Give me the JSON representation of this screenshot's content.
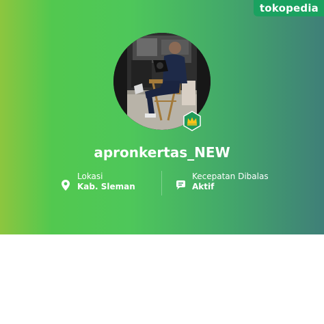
{
  "brand": {
    "logo_text": "tokopedia",
    "color": "#1aa260"
  },
  "profile": {
    "username": "apronkertas_NEW",
    "badge_icon": "crown-icon",
    "avatar": "profile-photo"
  },
  "info": {
    "location": {
      "icon": "location-pin-icon",
      "label": "Lokasi",
      "value": "Kab. Sleman"
    },
    "response": {
      "icon": "chat-bubble-icon",
      "label": "Kecepatan Dibalas",
      "value": "Aktif"
    }
  },
  "colors": {
    "gradient_start": "#8dc63f",
    "gradient_mid": "#4ec75a",
    "gradient_end": "#3f7f78",
    "badge_green": "#1f9b58",
    "crown_yellow": "#f7c21a"
  }
}
